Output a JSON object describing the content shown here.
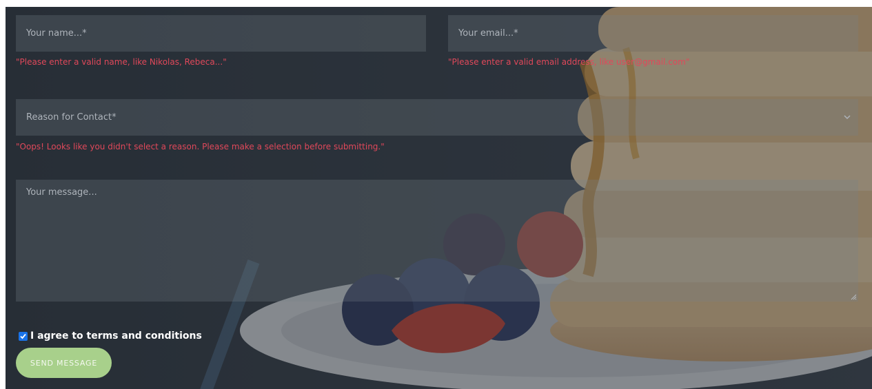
{
  "form": {
    "name": {
      "placeholder": "Your name...*",
      "error": "\"Please enter a valid name, like Nikolas, Rebeca...\""
    },
    "email": {
      "placeholder": "Your email...*",
      "error": "\"Please enter a valid email address, like user@gmail.com\""
    },
    "reason": {
      "selected": "Reason for Contact*",
      "error": "\"Oops! Looks like you didn't select a reason. Please make a selection before submitting.\""
    },
    "message": {
      "placeholder": "Your message..."
    },
    "agree": {
      "label": "I agree to terms and conditions",
      "checked": true
    },
    "submit_label": "SEND MESSAGE"
  },
  "colors": {
    "error": "#e0485a",
    "button": "#a8d08b",
    "checkbox": "#1a73e8"
  },
  "icons": {
    "select": "chevron-down-icon",
    "check": "checkmark-icon",
    "resize": "resize-handle-icon"
  }
}
